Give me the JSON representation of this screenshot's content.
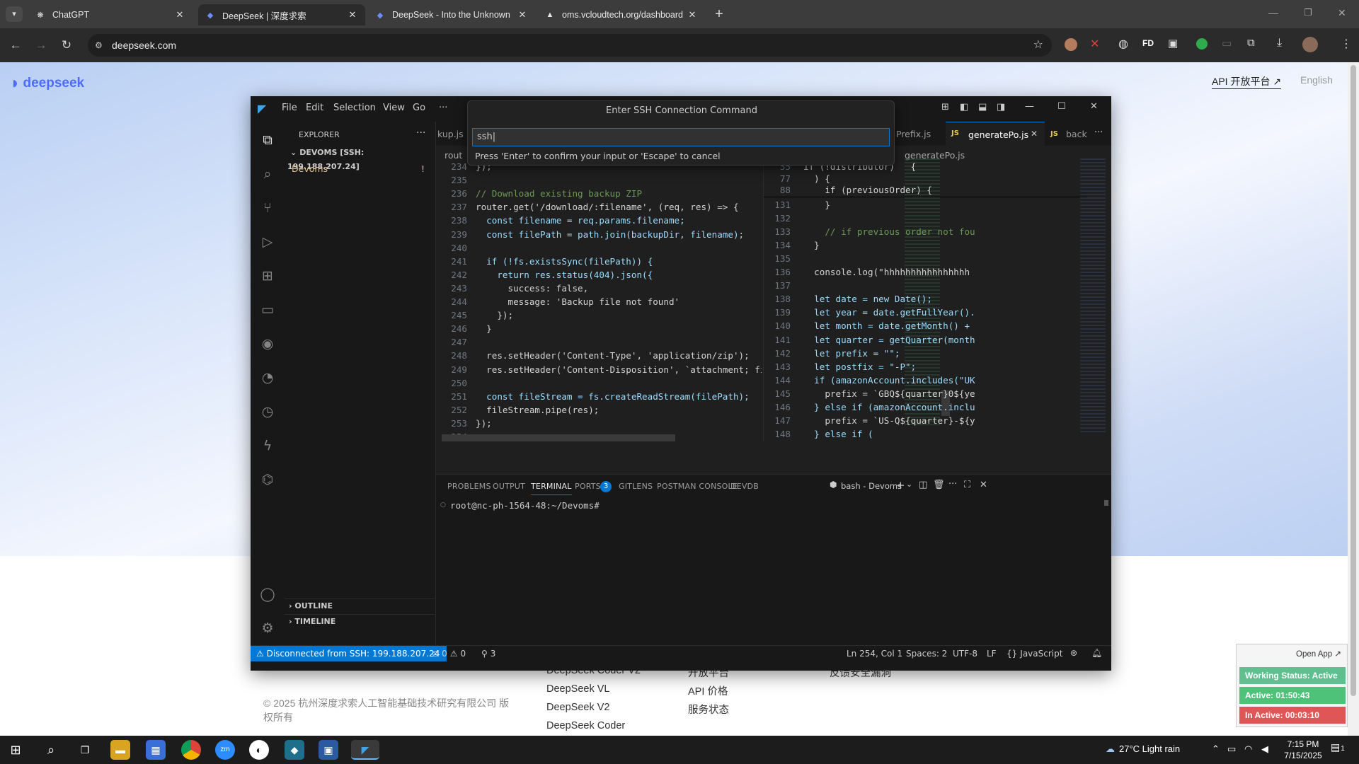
{
  "browser": {
    "tabs": [
      {
        "title": "ChatGPT",
        "icon": "chatgpt-icon",
        "active": false
      },
      {
        "title": "DeepSeek | 深度求索",
        "icon": "deepseek-icon",
        "active": true
      },
      {
        "title": "DeepSeek - Into the Unknown",
        "icon": "deepseek-icon",
        "active": false
      },
      {
        "title": "oms.vcloudtech.org/dashboard",
        "icon": "triangle-icon",
        "active": false
      }
    ],
    "new_tab": "+",
    "url": "deepseek.com",
    "ext_fd": "FD"
  },
  "page": {
    "logo": "deepseek",
    "api_link": "API 开放平台 ↗",
    "lang": "English",
    "copyright": "© 2025 杭州深度求索人工智能基础技术研究有限公司 版权所有",
    "footer_col1": [
      "DeepSeek Coder V2",
      "DeepSeek VL",
      "DeepSeek V2",
      "DeepSeek Coder"
    ],
    "footer_col2": [
      "开放平台",
      "API 价格",
      "服务状态"
    ],
    "footer_col3": [
      "反馈安全漏洞"
    ]
  },
  "vscode": {
    "menus": [
      "File",
      "Edit",
      "Selection",
      "View",
      "Go",
      "···"
    ],
    "quick_input": {
      "title": "Enter SSH Connection Command",
      "value": "ssh",
      "message": "Press 'Enter' to confirm your input or 'Escape' to cancel"
    },
    "explorer": {
      "title": "EXPLORER",
      "root": "DEVOMS [SSH: 199.188.207.24]",
      "folder": "Devoms",
      "folder_badge": "!",
      "outline": "OUTLINE",
      "timeline": "TIMELINE"
    },
    "editor_tabs": [
      "kup.js",
      "Prefix.js",
      "generatePo.js",
      "back"
    ],
    "breadcrumb_left": "rout",
    "breadcrumb_right": "generatePo.js",
    "left_lines": [
      {
        "n": "234",
        "t": "});"
      },
      {
        "n": "235",
        "t": ""
      },
      {
        "n": "236",
        "t": "// Download existing backup ZIP"
      },
      {
        "n": "237",
        "t": "router.get('/download/:filename', (req, res) => {"
      },
      {
        "n": "238",
        "t": "  const filename = req.params.filename;"
      },
      {
        "n": "239",
        "t": "  const filePath = path.join(backupDir, filename);"
      },
      {
        "n": "240",
        "t": ""
      },
      {
        "n": "241",
        "t": "  if (!fs.existsSync(filePath)) {"
      },
      {
        "n": "242",
        "t": "    return res.status(404).json({"
      },
      {
        "n": "243",
        "t": "      success: false,"
      },
      {
        "n": "244",
        "t": "      message: 'Backup file not found'"
      },
      {
        "n": "245",
        "t": "    });"
      },
      {
        "n": "246",
        "t": "  }"
      },
      {
        "n": "247",
        "t": ""
      },
      {
        "n": "248",
        "t": "  res.setHeader('Content-Type', 'application/zip');"
      },
      {
        "n": "249",
        "t": "  res.setHeader('Content-Disposition', `attachment; file"
      },
      {
        "n": "250",
        "t": ""
      },
      {
        "n": "251",
        "t": "  const fileStream = fs.createReadStream(filePath);"
      },
      {
        "n": "252",
        "t": "  fileStream.pipe(res);"
      },
      {
        "n": "253",
        "t": "});"
      },
      {
        "n": "254",
        "t": ""
      }
    ],
    "right_sticky": [
      {
        "n": "55",
        "t": "if (!distributor)   {"
      },
      {
        "n": "77",
        "t": "  ) {"
      },
      {
        "n": "88",
        "t": "    if (previousOrder) {"
      }
    ],
    "right_lines": [
      {
        "n": "131",
        "t": "    }"
      },
      {
        "n": "132",
        "t": ""
      },
      {
        "n": "133",
        "t": "    // if previous order not fou"
      },
      {
        "n": "134",
        "t": "  }"
      },
      {
        "n": "135",
        "t": ""
      },
      {
        "n": "136",
        "t": "  console.log(\"hhhhhhhhhhhhhhhh"
      },
      {
        "n": "137",
        "t": ""
      },
      {
        "n": "138",
        "t": "  let date = new Date();"
      },
      {
        "n": "139",
        "t": "  let year = date.getFullYear()."
      },
      {
        "n": "140",
        "t": "  let month = date.getMonth() +"
      },
      {
        "n": "141",
        "t": "  let quarter = getQuarter(month"
      },
      {
        "n": "142",
        "t": "  let prefix = \"\";"
      },
      {
        "n": "143",
        "t": "  let postfix = \"-P\";"
      },
      {
        "n": "144",
        "t": "  if (amazonAccount.includes(\"UK"
      },
      {
        "n": "145",
        "t": "    prefix = `GBQ${quarter}0${ye"
      },
      {
        "n": "146",
        "t": "  } else if (amazonAccount.inclu"
      },
      {
        "n": "147",
        "t": "    prefix = `US-Q${quarter}-${y"
      },
      {
        "n": "148",
        "t": "  } else if ("
      }
    ],
    "panel_tabs": [
      "PROBLEMS",
      "OUTPUT",
      "TERMINAL",
      "PORTS",
      "GITLENS",
      "POSTMAN CONSOLE",
      "DEVDB"
    ],
    "ports_badge": "3",
    "terminal_name": "bash - Devoms",
    "terminal_prompt": "root@nc-ph-1564-48:~/Devoms#",
    "status": {
      "remote": "⚠ Disconnected from SSH: 199.188.207.24",
      "errors": "0",
      "warnings": "0",
      "ports": "3",
      "position": "Ln 254, Col 1",
      "spaces": "Spaces: 2",
      "encoding": "UTF-8",
      "eol": "LF",
      "language": "JavaScript"
    }
  },
  "widget": {
    "open_app": "Open App ↗",
    "working": "Working Status: Active",
    "active": "Active: 01:50:43",
    "inactive": "In Active: 00:03:10"
  },
  "taskbar": {
    "weather": "27°C  Light rain",
    "time": "7:15 PM",
    "date": "7/15/2025",
    "notif": "1"
  },
  "colors": {
    "vscode_blue": "#0078d4",
    "widget_active": "#4fc27a",
    "widget_inactive": "#e05656",
    "widget_status": "#5fbf8f"
  }
}
